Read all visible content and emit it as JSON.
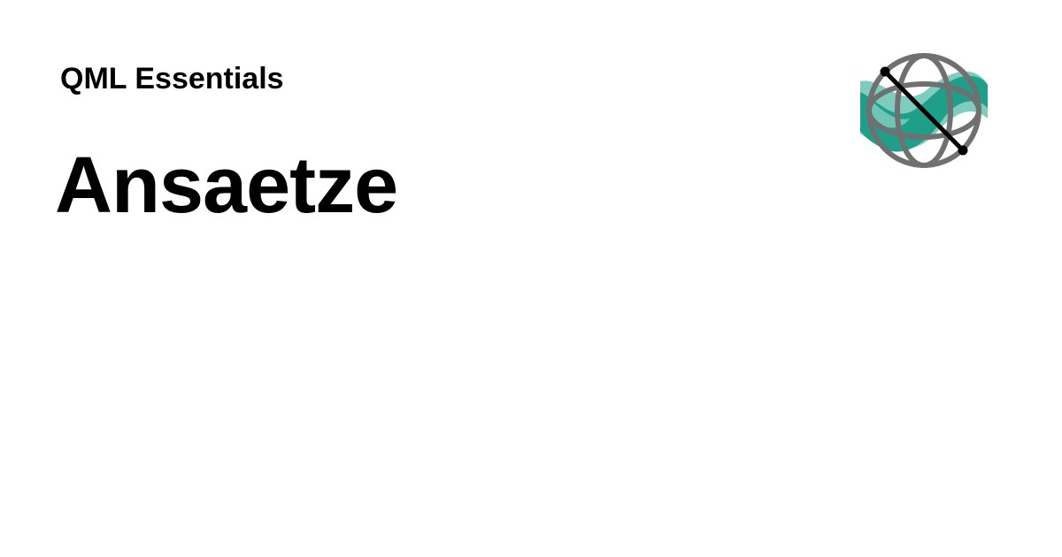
{
  "header": {
    "site_name": "QML Essentials"
  },
  "main": {
    "title": "Ansaetze"
  },
  "logo": {
    "icon": "bloch-sphere-wave-logo",
    "colors": {
      "wave_dark": "#1f9e89",
      "wave_light": "#7fcbbd",
      "sphere": "#707070",
      "axis": "#000000"
    }
  }
}
